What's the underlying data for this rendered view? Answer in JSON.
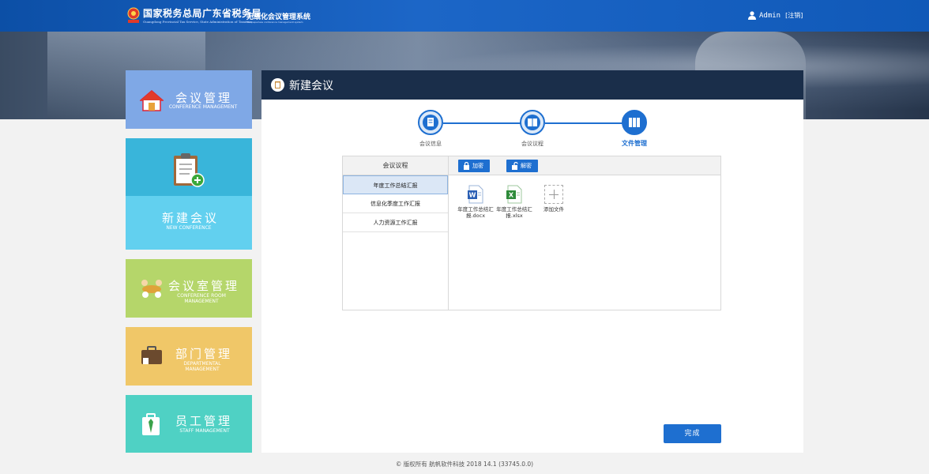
{
  "header": {
    "brand_cn": "国家税务总局广东省税务局",
    "brand_en": "Guangdong Provincial Tax Service, State Administration of Taxation",
    "system_cn": "无纸化会议管理系统",
    "system_en": "The paperless conference management system",
    "user_name": "Admin",
    "logout_label": "[注销]"
  },
  "sidebar": {
    "items": [
      {
        "cn": "会议管理",
        "en": "CONFERENCE MANAGEMENT",
        "icon": "house-icon",
        "color": "#7fa8e6"
      },
      {
        "cn": "新建会议",
        "en": "NEW CONFERENCE",
        "icon": "clipboard-add-icon",
        "color": "#62d0ef"
      },
      {
        "cn": "会议室管理",
        "en": "CONFERENCE ROOM MANAGEMENT",
        "icon": "meeting-icon",
        "color": "#b5d66a"
      },
      {
        "cn": "部门管理",
        "en": "DEPARTMENTAL MANAGEMENT",
        "icon": "briefcase-icon",
        "color": "#f0c768"
      },
      {
        "cn": "员工管理",
        "en": "STAFF MANAGEMENT",
        "icon": "staff-icon",
        "color": "#4fd1c4"
      }
    ]
  },
  "panel": {
    "title": "新建会议",
    "steps": [
      {
        "label": "会议信息",
        "state": "done"
      },
      {
        "label": "会议议程",
        "state": "done"
      },
      {
        "label": "文件管理",
        "state": "active"
      }
    ],
    "agenda_header": "会议议程",
    "agenda_items": [
      "年度工作总结汇报",
      "信息化季度工作汇报",
      "人力资源工作汇报"
    ],
    "selected_agenda": "年度工作总结汇报",
    "encrypt_label": "加密",
    "decrypt_label": "解密",
    "files": [
      {
        "name": "年度工作总结汇报.docx",
        "icon": "word-file-icon"
      },
      {
        "name": "年度工作总结汇报.xlsx",
        "icon": "excel-file-icon"
      }
    ],
    "add_file_label": "添加文件",
    "finish_label": "完成"
  },
  "footer": {
    "text": "© 版权所有 航帆软件科技 2018   14.1 (33745.0.0)"
  },
  "colors": {
    "accent": "#1e6fd0",
    "header": "#1059b8",
    "panel_head": "#1a2e4a"
  }
}
